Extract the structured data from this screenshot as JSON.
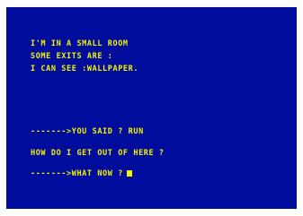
{
  "colors": {
    "screen_background": "#000c9c",
    "text": "#f4f400",
    "border": "#ffffff"
  },
  "room_description": [
    "I'M IN A SMALL ROOM",
    "SOME EXITS ARE :",
    "I CAN SEE :WALLPAPER."
  ],
  "player_command": "------->YOU SAID ? RUN",
  "game_response": "HOW DO I GET OUT OF HERE ?",
  "prompt": "------->WHAT NOW ?",
  "cursor_icon": "block-cursor-icon"
}
